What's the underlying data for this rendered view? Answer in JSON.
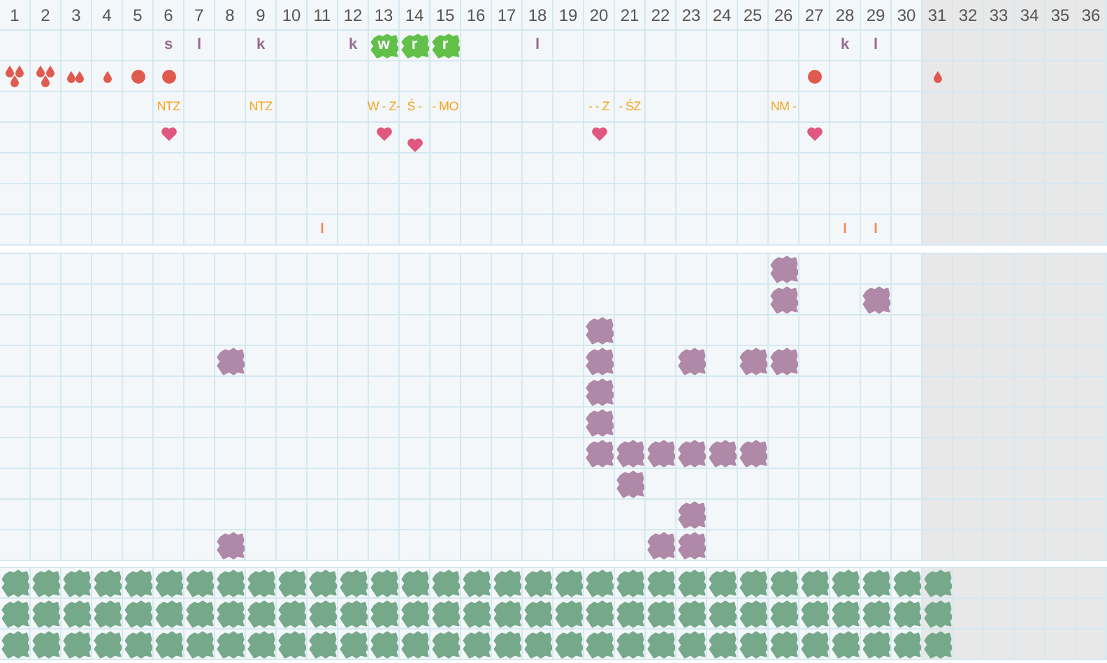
{
  "days": [
    {
      "label": "1",
      "shaded": false,
      "flow": {
        "kind": "heavy"
      },
      "symptoms": [
        false,
        false,
        false,
        false,
        false,
        false,
        false,
        false,
        false,
        false
      ],
      "pills": [
        true,
        true,
        true
      ]
    },
    {
      "label": "2",
      "shaded": false,
      "flow": {
        "kind": "heavy"
      },
      "symptoms": [
        false,
        false,
        false,
        false,
        false,
        false,
        false,
        false,
        false,
        false
      ],
      "pills": [
        true,
        true,
        true
      ]
    },
    {
      "label": "3",
      "shaded": false,
      "flow": {
        "kind": "medium"
      },
      "symptoms": [
        false,
        false,
        false,
        false,
        false,
        false,
        false,
        false,
        false,
        false
      ],
      "pills": [
        true,
        true,
        true
      ]
    },
    {
      "label": "4",
      "shaded": false,
      "flow": {
        "kind": "light"
      },
      "symptoms": [
        false,
        false,
        false,
        false,
        false,
        false,
        false,
        false,
        false,
        false
      ],
      "pills": [
        true,
        true,
        true
      ]
    },
    {
      "label": "5",
      "shaded": false,
      "flow": {
        "kind": "dot"
      },
      "symptoms": [
        false,
        false,
        false,
        false,
        false,
        false,
        false,
        false,
        false,
        false
      ],
      "pills": [
        true,
        true,
        true
      ]
    },
    {
      "label": "6",
      "shaded": false,
      "letter": {
        "text": "s",
        "kind": "plain"
      },
      "flow": {
        "kind": "dot"
      },
      "note": "NTZ",
      "heart": {
        "low": false
      },
      "symptoms": [
        false,
        false,
        false,
        false,
        false,
        false,
        false,
        false,
        false,
        false
      ],
      "pills": [
        true,
        true,
        true
      ]
    },
    {
      "label": "7",
      "shaded": false,
      "letter": {
        "text": "l",
        "kind": "plain"
      },
      "symptoms": [
        false,
        false,
        false,
        false,
        false,
        false,
        false,
        false,
        false,
        false
      ],
      "pills": [
        true,
        true,
        true
      ]
    },
    {
      "label": "8",
      "shaded": false,
      "symptoms": [
        false,
        false,
        false,
        true,
        false,
        false,
        false,
        false,
        false,
        true
      ],
      "pills": [
        true,
        true,
        true
      ]
    },
    {
      "label": "9",
      "shaded": false,
      "letter": {
        "text": "k",
        "kind": "plain"
      },
      "note": "NTZ",
      "symptoms": [
        false,
        false,
        false,
        false,
        false,
        false,
        false,
        false,
        false,
        false
      ],
      "pills": [
        true,
        true,
        true
      ]
    },
    {
      "label": "10",
      "shaded": false,
      "symptoms": [
        false,
        false,
        false,
        false,
        false,
        false,
        false,
        false,
        false,
        false
      ],
      "pills": [
        true,
        true,
        true
      ]
    },
    {
      "label": "11",
      "shaded": false,
      "mark": "l",
      "symptoms": [
        false,
        false,
        false,
        false,
        false,
        false,
        false,
        false,
        false,
        false
      ],
      "pills": [
        true,
        true,
        true
      ]
    },
    {
      "label": "12",
      "shaded": false,
      "letter": {
        "text": "k",
        "kind": "plain"
      },
      "symptoms": [
        false,
        false,
        false,
        false,
        false,
        false,
        false,
        false,
        false,
        false
      ],
      "pills": [
        true,
        true,
        true
      ]
    },
    {
      "label": "13",
      "shaded": false,
      "letter": {
        "text": "w",
        "kind": "badge"
      },
      "note": "W - Z-",
      "heart": {
        "low": false
      },
      "symptoms": [
        false,
        false,
        false,
        false,
        false,
        false,
        false,
        false,
        false,
        false
      ],
      "pills": [
        true,
        true,
        true
      ]
    },
    {
      "label": "14",
      "shaded": false,
      "letter": {
        "text": "r",
        "kind": "badge"
      },
      "note": "Ś -",
      "heart": {
        "low": true
      },
      "symptoms": [
        false,
        false,
        false,
        false,
        false,
        false,
        false,
        false,
        false,
        false
      ],
      "pills": [
        true,
        true,
        true
      ]
    },
    {
      "label": "15",
      "shaded": false,
      "letter": {
        "text": "r",
        "kind": "badge"
      },
      "note": "- MO",
      "symptoms": [
        false,
        false,
        false,
        false,
        false,
        false,
        false,
        false,
        false,
        false
      ],
      "pills": [
        true,
        true,
        true
      ]
    },
    {
      "label": "16",
      "shaded": false,
      "symptoms": [
        false,
        false,
        false,
        false,
        false,
        false,
        false,
        false,
        false,
        false
      ],
      "pills": [
        true,
        true,
        true
      ]
    },
    {
      "label": "17",
      "shaded": false,
      "symptoms": [
        false,
        false,
        false,
        false,
        false,
        false,
        false,
        false,
        false,
        false
      ],
      "pills": [
        true,
        true,
        true
      ]
    },
    {
      "label": "18",
      "shaded": false,
      "letter": {
        "text": "l",
        "kind": "plain"
      },
      "symptoms": [
        false,
        false,
        false,
        false,
        false,
        false,
        false,
        false,
        false,
        false
      ],
      "pills": [
        true,
        true,
        true
      ]
    },
    {
      "label": "19",
      "shaded": false,
      "symptoms": [
        false,
        false,
        false,
        false,
        false,
        false,
        false,
        false,
        false,
        false
      ],
      "pills": [
        true,
        true,
        true
      ]
    },
    {
      "label": "20",
      "shaded": false,
      "note": "- - Z",
      "heart": {
        "low": false
      },
      "symptoms": [
        false,
        false,
        true,
        true,
        true,
        true,
        true,
        false,
        false,
        false
      ],
      "pills": [
        true,
        true,
        true
      ]
    },
    {
      "label": "21",
      "shaded": false,
      "note": "- ŚZ",
      "symptoms": [
        false,
        false,
        false,
        false,
        false,
        false,
        true,
        true,
        false,
        false
      ],
      "pills": [
        true,
        true,
        true
      ]
    },
    {
      "label": "22",
      "shaded": false,
      "symptoms": [
        false,
        false,
        false,
        false,
        false,
        false,
        true,
        false,
        false,
        true
      ],
      "pills": [
        true,
        true,
        true
      ]
    },
    {
      "label": "23",
      "shaded": false,
      "symptoms": [
        false,
        false,
        false,
        true,
        false,
        false,
        true,
        false,
        true,
        true
      ],
      "pills": [
        true,
        true,
        true
      ]
    },
    {
      "label": "24",
      "shaded": false,
      "symptoms": [
        false,
        false,
        false,
        false,
        false,
        false,
        true,
        false,
        false,
        false
      ],
      "pills": [
        true,
        true,
        true
      ]
    },
    {
      "label": "25",
      "shaded": false,
      "symptoms": [
        false,
        false,
        false,
        true,
        false,
        false,
        true,
        false,
        false,
        false
      ],
      "pills": [
        true,
        true,
        true
      ]
    },
    {
      "label": "26",
      "shaded": false,
      "note": "NM -",
      "symptoms": [
        true,
        true,
        false,
        true,
        false,
        false,
        false,
        false,
        false,
        false
      ],
      "pills": [
        true,
        true,
        true
      ]
    },
    {
      "label": "27",
      "shaded": false,
      "flow": {
        "kind": "dot"
      },
      "heart": {
        "low": false
      },
      "symptoms": [
        false,
        false,
        false,
        false,
        false,
        false,
        false,
        false,
        false,
        false
      ],
      "pills": [
        true,
        true,
        true
      ]
    },
    {
      "label": "28",
      "shaded": false,
      "letter": {
        "text": "k",
        "kind": "plain"
      },
      "mark": "l",
      "symptoms": [
        false,
        false,
        false,
        false,
        false,
        false,
        false,
        false,
        false,
        false
      ],
      "pills": [
        true,
        true,
        true
      ]
    },
    {
      "label": "29",
      "shaded": false,
      "letter": {
        "text": "l",
        "kind": "plain"
      },
      "mark": "l",
      "symptoms": [
        false,
        true,
        false,
        false,
        false,
        false,
        false,
        false,
        false,
        false
      ],
      "pills": [
        true,
        true,
        true
      ]
    },
    {
      "label": "30",
      "shaded": false,
      "symptoms": [
        false,
        false,
        false,
        false,
        false,
        false,
        false,
        false,
        false,
        false
      ],
      "pills": [
        true,
        true,
        true
      ]
    },
    {
      "label": "31",
      "shaded": true,
      "flow": {
        "kind": "light"
      },
      "symptoms": [
        false,
        false,
        false,
        false,
        false,
        false,
        false,
        false,
        false,
        false
      ],
      "pills": [
        true,
        true,
        true
      ]
    },
    {
      "label": "32",
      "shaded": true,
      "symptoms": [
        false,
        false,
        false,
        false,
        false,
        false,
        false,
        false,
        false,
        false
      ],
      "pills": [
        false,
        false,
        false
      ]
    },
    {
      "label": "33",
      "shaded": true,
      "symptoms": [
        false,
        false,
        false,
        false,
        false,
        false,
        false,
        false,
        false,
        false
      ],
      "pills": [
        false,
        false,
        false
      ]
    },
    {
      "label": "34",
      "shaded": true,
      "symptoms": [
        false,
        false,
        false,
        false,
        false,
        false,
        false,
        false,
        false,
        false
      ],
      "pills": [
        false,
        false,
        false
      ]
    },
    {
      "label": "35",
      "shaded": true,
      "symptoms": [
        false,
        false,
        false,
        false,
        false,
        false,
        false,
        false,
        false,
        false
      ],
      "pills": [
        false,
        false,
        false
      ]
    },
    {
      "label": "36",
      "shaded": true,
      "symptoms": [
        false,
        false,
        false,
        false,
        false,
        false,
        false,
        false,
        false,
        false
      ],
      "pills": [
        false,
        false,
        false
      ]
    }
  ]
}
